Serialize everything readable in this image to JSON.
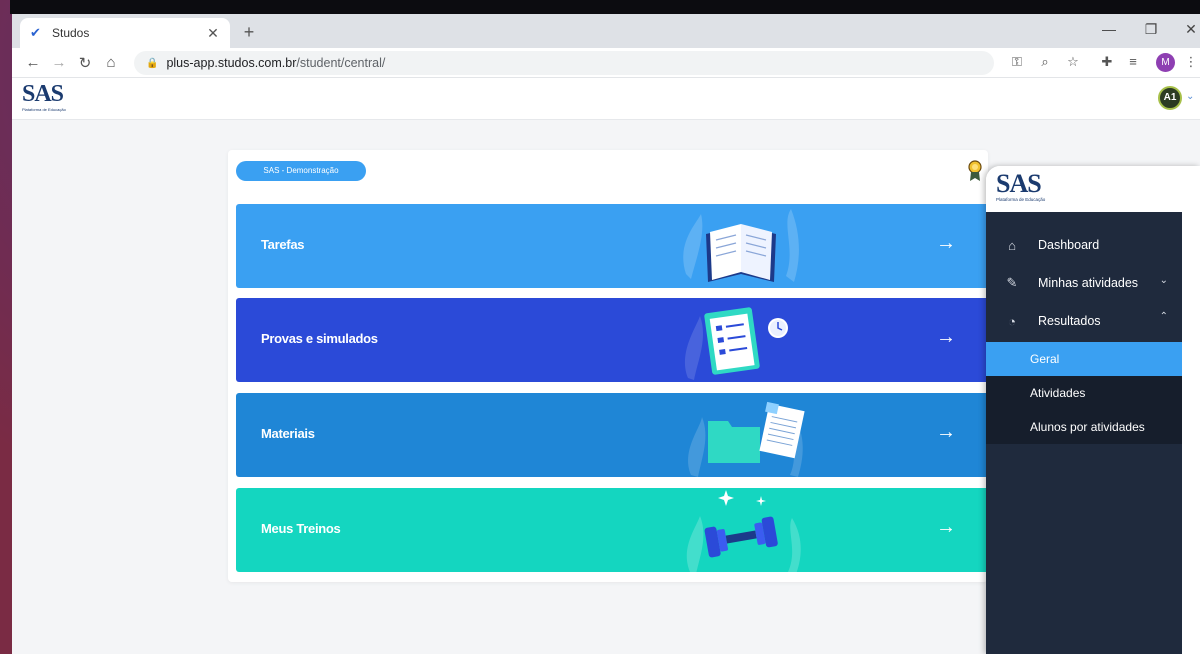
{
  "browser": {
    "tab_title": "Studos",
    "url_host": "plus-app.studos.com.br",
    "url_path": "/student/central/",
    "profile_initial": "M"
  },
  "app": {
    "logo": "SAS",
    "logo_subtitle": "Plataforma de Educação",
    "avatar_initials": "A1"
  },
  "content": {
    "org_label": "SAS - Demonstração",
    "tiles": [
      {
        "label": "Tarefas",
        "color": "#3aa0f2"
      },
      {
        "label": "Provas e simulados",
        "color": "#2b4ad8"
      },
      {
        "label": "Materiais",
        "color": "#1f86d6"
      },
      {
        "label": "Meus Treinos",
        "color": "#14d6c0"
      }
    ]
  },
  "panel": {
    "logo": "SAS",
    "logo_subtitle": "Plataforma de Educação",
    "nav": [
      {
        "label": "Dashboard",
        "icon": "home-icon"
      },
      {
        "label": "Minhas atividades",
        "icon": "pencil-icon",
        "expanded": false
      },
      {
        "label": "Resultados",
        "icon": "pie-chart-icon",
        "expanded": true
      }
    ],
    "sub_items": [
      {
        "label": "Geral",
        "active": true
      },
      {
        "label": "Atividades",
        "active": false
      },
      {
        "label": "Alunos por atividades",
        "active": false
      }
    ]
  }
}
